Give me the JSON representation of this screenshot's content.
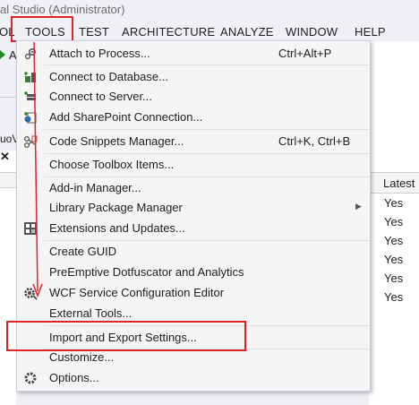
{
  "window": {
    "title": "al Studio (Administrator)"
  },
  "menubar": {
    "items": [
      "OL",
      "TOOLS",
      "TEST",
      "ARCHITECTURE",
      "ANALYZE",
      "WINDOW",
      "HELP"
    ],
    "toolbar_partial_letter": "A",
    "partial_left_text": "uoV"
  },
  "tools_menu": {
    "items": [
      {
        "label": "Attach to Process...",
        "shortcut": "Ctrl+Alt+P",
        "icon": "attach-process-icon"
      },
      {
        "label": "Connect to Database...",
        "icon": "connect-database-icon"
      },
      {
        "label": "Connect to Server...",
        "icon": "connect-server-icon"
      },
      {
        "label": "Add SharePoint Connection...",
        "icon": "sharepoint-icon"
      },
      {
        "label": "Code Snippets Manager...",
        "shortcut": "Ctrl+K, Ctrl+B",
        "icon": "code-snippets-icon"
      },
      {
        "label": "Choose Toolbox Items..."
      },
      {
        "label": "Add-in Manager..."
      },
      {
        "label": "Library Package Manager",
        "submenu": true
      },
      {
        "label": "Extensions and Updates...",
        "icon": "extensions-icon"
      },
      {
        "label": "Create GUID"
      },
      {
        "label": "PreEmptive Dotfuscator and Analytics"
      },
      {
        "label": "WCF Service Configuration Editor",
        "icon": "wcf-gear-icon"
      },
      {
        "label": "External Tools..."
      },
      {
        "label": "Import and Export Settings..."
      },
      {
        "label": "Customize..."
      },
      {
        "label": "Options...",
        "icon": "options-gear-icon"
      }
    ]
  },
  "right_panel": {
    "header": "Latest",
    "values": [
      "Yes",
      "Yes",
      "Yes",
      "Yes",
      "Yes",
      "Yes"
    ]
  },
  "annotation": {
    "color": "#e02424"
  }
}
